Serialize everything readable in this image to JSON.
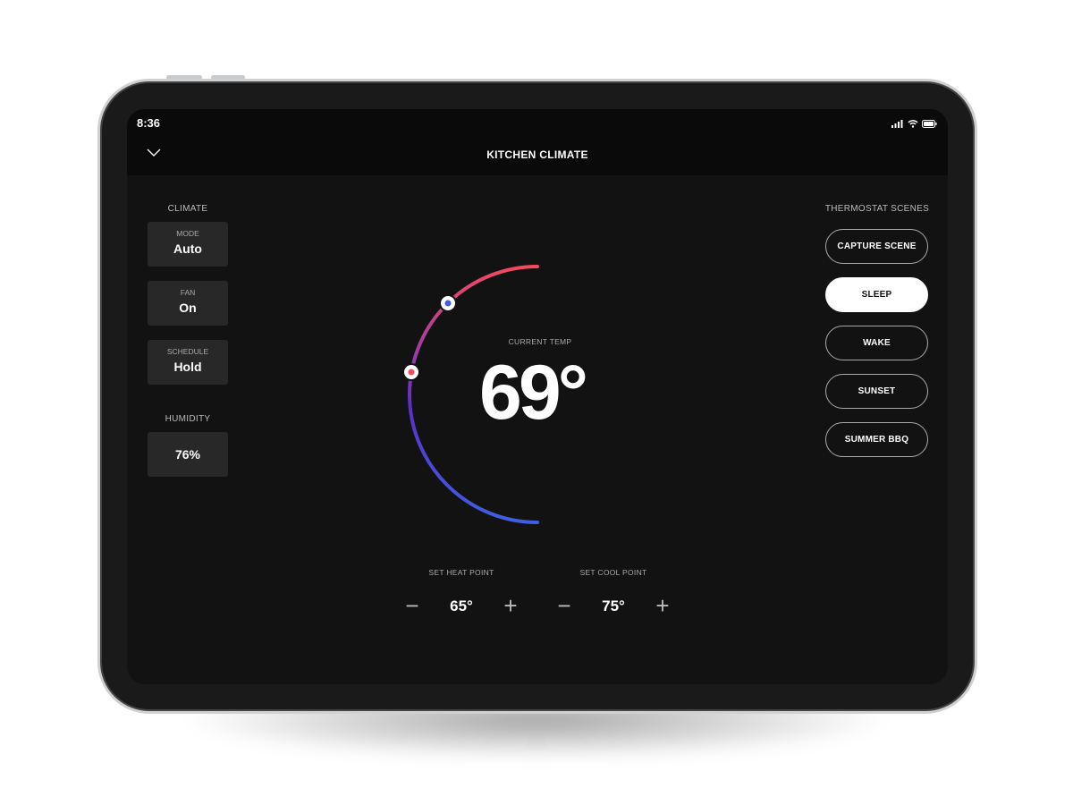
{
  "status": {
    "time": "8:36",
    "icons": [
      "signal-icon",
      "wifi-icon",
      "battery-icon"
    ]
  },
  "header": {
    "title": "KITCHEN CLIMATE",
    "back_icon": "chevron-down-icon"
  },
  "climate": {
    "heading": "CLIMATE",
    "cards": [
      {
        "label": "MODE",
        "value": "Auto"
      },
      {
        "label": "FAN",
        "value": "On"
      },
      {
        "label": "SCHEDULE",
        "value": "Hold"
      }
    ]
  },
  "humidity": {
    "heading": "HUMIDITY",
    "value": "76%"
  },
  "thermostat": {
    "label": "CURRENT TEMP",
    "value": "69°",
    "heat_point": 65,
    "cool_point": 75,
    "colors": {
      "warm": "#f4495f",
      "mid": "#9b3ba6",
      "cool": "#3f5fe0"
    }
  },
  "setpoints": [
    {
      "label": "SET HEAT POINT",
      "value": "65°"
    },
    {
      "label": "SET COOL POINT",
      "value": "75°"
    }
  ],
  "scenes": {
    "heading": "THERMOSTAT SCENES",
    "items": [
      {
        "label": "CAPTURE SCENE",
        "active": false
      },
      {
        "label": "SLEEP",
        "active": true
      },
      {
        "label": "WAKE",
        "active": false
      },
      {
        "label": "SUNSET",
        "active": false
      },
      {
        "label": "SUMMER BBQ",
        "active": false
      }
    ]
  }
}
